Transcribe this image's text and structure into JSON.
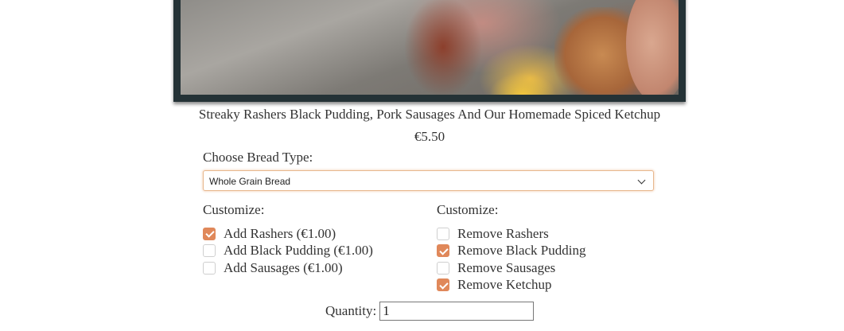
{
  "product": {
    "title": "Streaky Rashers Black Pudding, Pork Sausages And Our Homemade Spiced Ketchup",
    "price": "€5.50"
  },
  "bread": {
    "label": "Choose Bread Type:",
    "selected": "Whole Grain Bread"
  },
  "customize_left": {
    "title": "Customize:",
    "options": [
      {
        "label": "Add Rashers (€1.00)",
        "checked": true
      },
      {
        "label": "Add Black Pudding (€1.00)",
        "checked": false
      },
      {
        "label": "Add Sausages (€1.00)",
        "checked": false
      }
    ]
  },
  "customize_right": {
    "title": "Customize:",
    "options": [
      {
        "label": "Remove Rashers",
        "checked": false
      },
      {
        "label": "Remove Black Pudding",
        "checked": true
      },
      {
        "label": "Remove Sausages",
        "checked": false
      },
      {
        "label": "Remove Ketchup",
        "checked": true
      }
    ]
  },
  "quantity": {
    "label": "Quantity:",
    "value": "1"
  },
  "colors": {
    "accent": "#e0885a",
    "frame": "#243236",
    "select_border": "#e7b88e"
  }
}
